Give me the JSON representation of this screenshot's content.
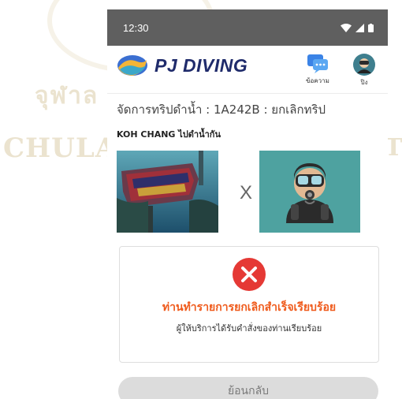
{
  "status_bar": {
    "time": "12:30"
  },
  "header": {
    "logo_text": "PJ DIVING",
    "chat_label": "ข้อความ",
    "user_label": "ปิง"
  },
  "breadcrumb": "จัดการทริปดำน้ำ : 1A242B : ยกเลิกทริป",
  "trip_title": "KOH CHANG ไปดำน้ำกัน",
  "separator": "X",
  "result": {
    "title": "ท่านทำรายการยกเลิกสำเร็จเรียบร้อย",
    "subtitle": "ผู้ให้บริการได้รับคำสั่งของท่านเรียบร้อย"
  },
  "back_button_label": "ย้อนกลับ",
  "watermark": {
    "line1": "จุฬาล",
    "line2": "CHULAL",
    "line3": "TY"
  },
  "colors": {
    "status_bar": "#5f5f5f",
    "brand_navy": "#1f2b6b",
    "accent_orange": "#ef5a1b",
    "error_red": "#e53935",
    "diver_bg": "#4ea2a0"
  }
}
